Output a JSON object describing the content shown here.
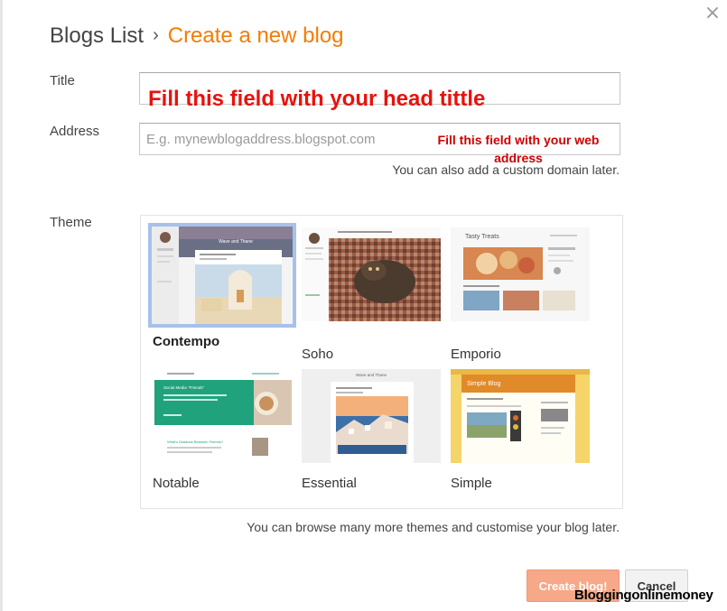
{
  "breadcrumb": {
    "root": "Blogs List",
    "separator": "›",
    "current": "Create a new blog"
  },
  "close_icon": "×",
  "form": {
    "title_label": "Title",
    "title_value": "",
    "address_label": "Address",
    "address_placeholder": "E.g. mynewblogaddress.blogspot.com",
    "address_hint": "You can also add a custom domain later.",
    "theme_label": "Theme"
  },
  "annotations": {
    "title_note": "Fill this field with your head tittle",
    "address_note": "Fill this field with your web address"
  },
  "themes": [
    {
      "name": "Contempo",
      "selected": true
    },
    {
      "name": "Soho",
      "selected": false
    },
    {
      "name": "Emporio",
      "selected": false
    },
    {
      "name": "Notable",
      "selected": false
    },
    {
      "name": "Essential",
      "selected": false
    },
    {
      "name": "Simple",
      "selected": false
    }
  ],
  "theme_thumbnail_text": {
    "contempo": "Wave and Thane",
    "emporio": "Tasty Treats",
    "notable": "Social Media \"Friends\"",
    "notable_sub": "What's Distance Between Friends?",
    "essential": "Wave and Thane",
    "simple": "Simple Blog"
  },
  "themes_hint": "You can browse many more themes and customise your blog later.",
  "buttons": {
    "create": "Create blog!",
    "cancel": "Cancel"
  },
  "watermark": "Bloggingonlinemoney",
  "colors": {
    "accent": "#f57c00",
    "annotation": "#e8120c",
    "selected_border": "#a7c1ea",
    "primary_button": "#f6a888"
  }
}
